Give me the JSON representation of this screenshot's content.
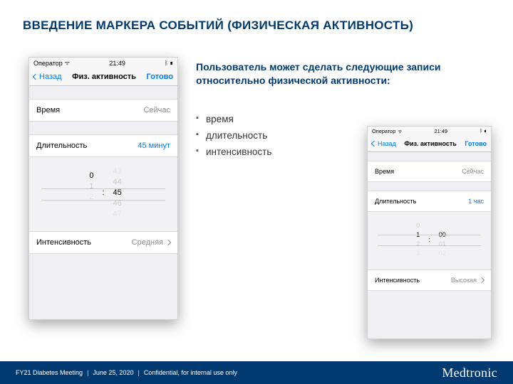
{
  "title": "ВВЕДЕНИЕ МАРКЕРА СОБЫТИЙ (ФИЗИЧЕСКАЯ АКТИВНОСТЬ)",
  "intro": "Пользователь может сделать следующие записи относительно физической активности:",
  "bullets": [
    "время",
    "длительность",
    "интенсивность"
  ],
  "footer": {
    "meeting": "FY21 Diabetes Meeting",
    "date": "June 25, 2020",
    "conf": "Confidential, for internal use only",
    "brand": "Medtronic"
  },
  "phoneA": {
    "status": {
      "carrier": "Оператор",
      "time": "21:49"
    },
    "nav": {
      "back": "Назад",
      "title": "Физ. активность",
      "done": "Готово"
    },
    "rows": {
      "timeLabel": "Время",
      "timeValue": "Сейчас",
      "durLabel": "Длительность",
      "durValue": "45 минут",
      "intLabel": "Интенсивность",
      "intValue": "Средняя"
    },
    "picker": {
      "h_m2": " ",
      "h_m1": " ",
      "h_sel": "0",
      "h_p1": "1",
      "h_p2": "2",
      "m_m2": "43",
      "m_m1": "44",
      "m_sel": "45",
      "m_p1": "46",
      "m_p2": "47"
    }
  },
  "phoneB": {
    "status": {
      "carrier": "Оператор",
      "time": "21:49"
    },
    "nav": {
      "back": "Назад",
      "title": "Физ. активность",
      "done": "Готово"
    },
    "rows": {
      "timeLabel": "Время",
      "timeValue": "Сейчас",
      "durLabel": "Длительность",
      "durValue": "1 час",
      "intLabel": "Интенсивность",
      "intValue": "Высокая"
    },
    "picker": {
      "h_m1": "0",
      "h_sel": "1",
      "h_p1": "2",
      "h_p2": "3",
      "m_sel": "00",
      "m_p1": "01",
      "m_p2": "02"
    }
  }
}
